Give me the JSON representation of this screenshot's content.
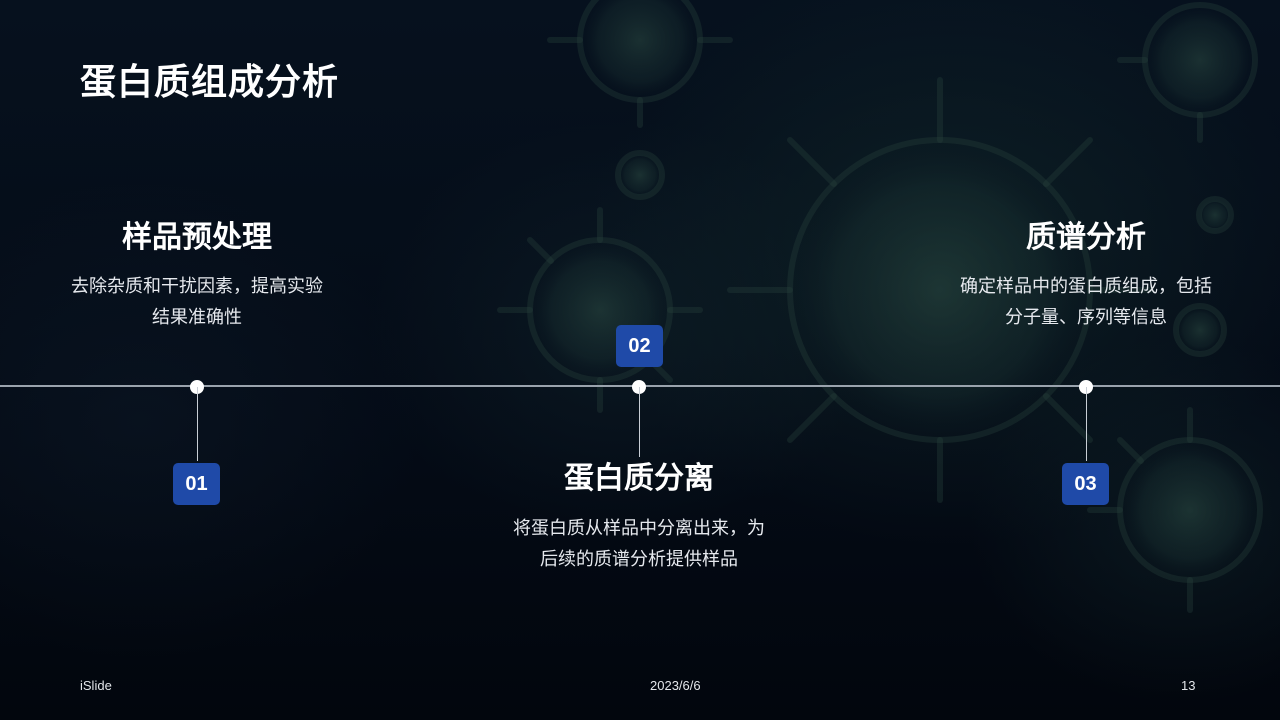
{
  "page": {
    "title": "蛋白质组成分析"
  },
  "steps": [
    {
      "number": "01",
      "title": "样品预处理",
      "desc_lines": [
        "去除杂质和干扰因素，提高实验",
        "结果准确性"
      ]
    },
    {
      "number": "02",
      "title": "蛋白质分离",
      "desc_lines": [
        "将蛋白质从样品中分离出来，为",
        "后续的质谱分析提供样品"
      ]
    },
    {
      "number": "03",
      "title": "质谱分析",
      "desc_lines": [
        "确定样品中的蛋白质组成，包括",
        "分子量、序列等信息"
      ]
    }
  ],
  "footer": {
    "brand": "iSlide",
    "date": "2023/6/6",
    "page_number": "13"
  },
  "colors": {
    "background": "#040b16",
    "badge": "#1f4aa8",
    "timeline": "#9aa3ad",
    "text": "#ffffff"
  }
}
